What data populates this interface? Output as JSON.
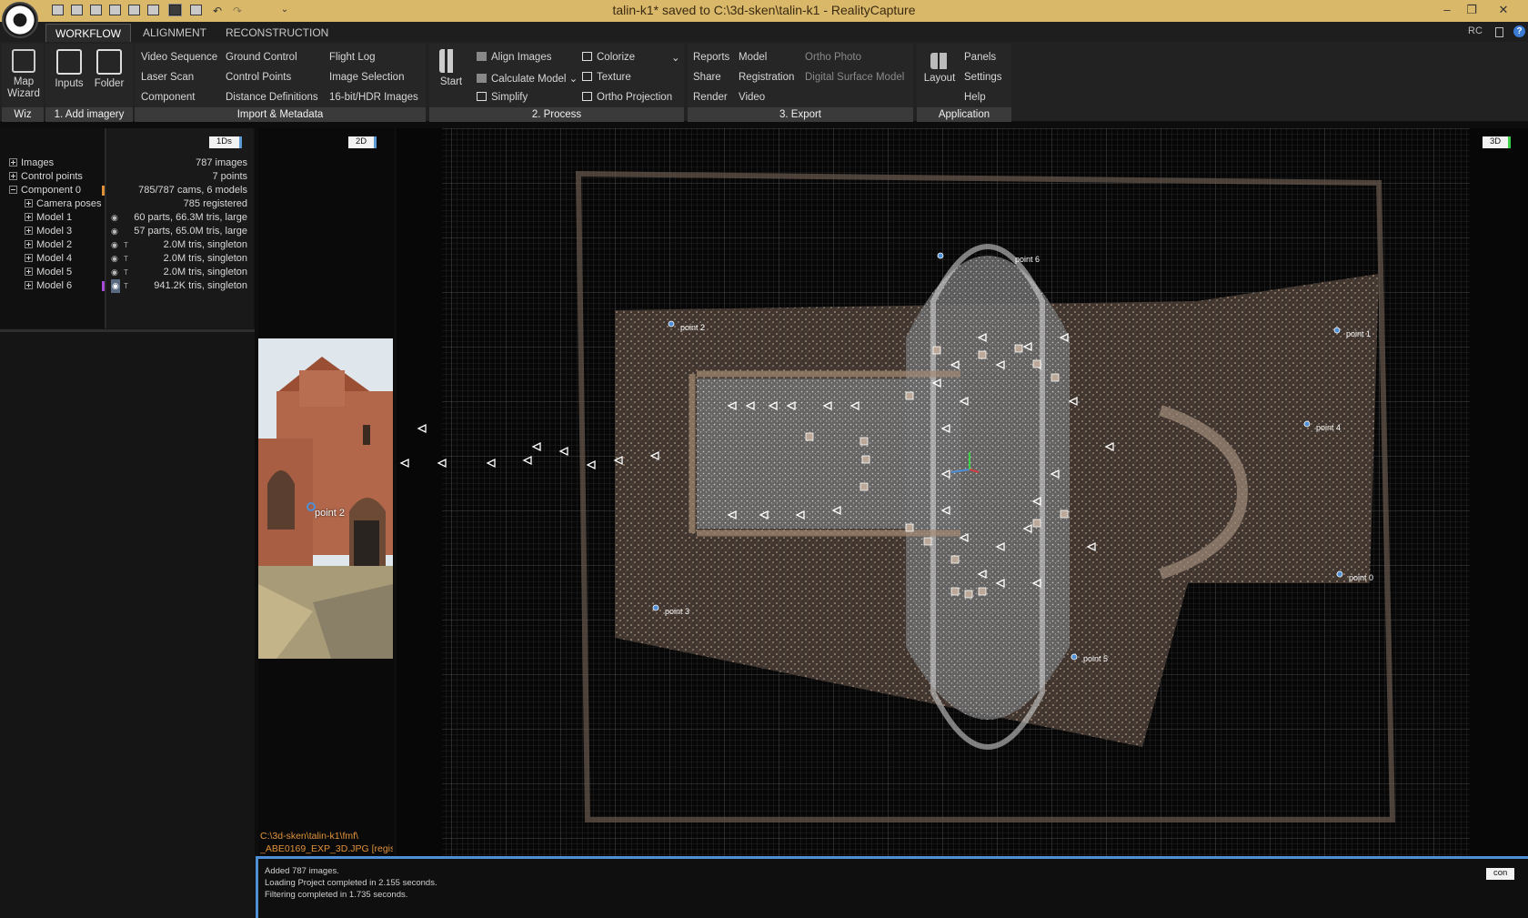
{
  "window": {
    "title": "talin-k1* saved to C:\\3d-sken\\talin-k1 - RealityCapture",
    "controls": [
      "–",
      "❐",
      "✕"
    ]
  },
  "tabs": [
    {
      "label": "WORKFLOW",
      "active": true
    },
    {
      "label": "ALIGNMENT",
      "active": false
    },
    {
      "label": "RECONSTRUCTION",
      "active": false
    }
  ],
  "tab_right": {
    "rc": "RC",
    "help": "?"
  },
  "ribbon": {
    "wiz": {
      "map_wizard": "Map Wizard",
      "label": "Wiz"
    },
    "add_imagery": {
      "inputs": "Inputs",
      "folder": "Folder",
      "label": "1. Add imagery"
    },
    "import_metadata": {
      "col1": [
        "Video Sequence",
        "Laser Scan",
        "Component"
      ],
      "col2": [
        "Ground Control",
        "Control Points",
        "Distance Definitions"
      ],
      "col3": [
        "Flight Log",
        "Image Selection",
        "16-bit/HDR Images"
      ],
      "label": "Import & Metadata"
    },
    "process": {
      "start": "Start",
      "col1": [
        "Align Images",
        "Calculate Model",
        "Simplify"
      ],
      "col2": [
        "Colorize",
        "Texture",
        "Ortho Projection"
      ],
      "label": "2. Process"
    },
    "export": {
      "col1": [
        "Reports",
        "Share",
        "Render"
      ],
      "col2": [
        "Model",
        "Registration",
        "Video"
      ],
      "col3": [
        "Ortho Photo",
        "Digital Surface Model"
      ],
      "label": "3. Export"
    },
    "application": {
      "layout": "Layout",
      "col": [
        "Panels",
        "Settings",
        "Help"
      ],
      "label": "Application"
    }
  },
  "tree_panel": {
    "tag": "1Ds",
    "rows": [
      {
        "label": "Images",
        "value": "787 images",
        "indent": 0
      },
      {
        "label": "Control points",
        "value": "7 points",
        "indent": 0
      },
      {
        "label": "Component 0",
        "value": "785/787 cams, 6 models",
        "indent": 0
      },
      {
        "label": "Camera poses",
        "value": "785 registered",
        "indent": 1
      },
      {
        "label": "Model 1",
        "value": "60 parts, 66.3M tris, large",
        "indent": 1
      },
      {
        "label": "Model 3",
        "value": "57 parts, 65.0M tris, large",
        "indent": 1
      },
      {
        "label": "Model 2",
        "value": "2.0M tris, singleton",
        "indent": 1
      },
      {
        "label": "Model 4",
        "value": "2.0M tris, singleton",
        "indent": 1
      },
      {
        "label": "Model 5",
        "value": "2.0M tris, singleton",
        "indent": 1
      },
      {
        "label": "Model 6",
        "value": "941.2K tris, singleton",
        "indent": 1
      }
    ]
  },
  "panel2d": {
    "tag": "2D",
    "point_label": "point 2",
    "path_line1": "C:\\3d-sken\\talin-k1\\fmf\\",
    "path_line2": "_ABE0169_EXP_3D.JPG [regis"
  },
  "viewport": {
    "tag": "3D",
    "points": [
      {
        "label": "point 6"
      },
      {
        "label": "point 2"
      },
      {
        "label": "point 1"
      },
      {
        "label": "point 4"
      },
      {
        "label": "point 0"
      },
      {
        "label": "point 3"
      },
      {
        "label": "point 5"
      }
    ]
  },
  "console": {
    "lines": [
      "Added 787 images.",
      "Loading Project completed in 2.155 seconds.",
      "Filtering completed in 1.735 seconds."
    ],
    "tag": "con"
  },
  "colors": {
    "titlebar": "#d9b86a",
    "accent_blue": "#4f8fd6",
    "component_orange": "#e0923a",
    "model6_purple": "#a64ad8"
  }
}
